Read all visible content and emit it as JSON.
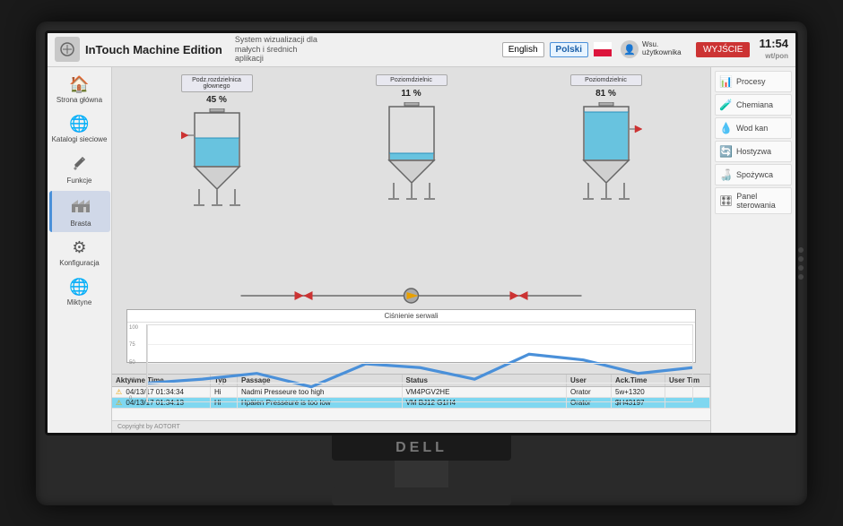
{
  "app": {
    "title": "InTouch Machine Edition",
    "subtitle": "System wizualizacji dla małych i średnich aplikacji",
    "logo_char": "🔧"
  },
  "header": {
    "lang_en": "English",
    "lang_pl": "Polski",
    "user_label": "Wsu. użytkownika",
    "logout_label": "WYJŚCIE",
    "time": "11:54",
    "date": "wt/pon"
  },
  "sidebar_left": {
    "items": [
      {
        "id": "strona-glowna",
        "label": "Strona główna",
        "icon": "🏠"
      },
      {
        "id": "katalogi-sieciowe",
        "label": "Katalogi sieciowe",
        "icon": "🌐"
      },
      {
        "id": "funkcje",
        "label": "Funkcje",
        "icon": "🔧"
      },
      {
        "id": "brasta",
        "label": "Brasta",
        "icon": "🏭",
        "active": true
      },
      {
        "id": "konfiguracja",
        "label": "Konfiguracja",
        "icon": "⚙"
      },
      {
        "id": "miktyne",
        "label": "Miktyne",
        "icon": "🌐"
      }
    ]
  },
  "sidebar_right": {
    "items": [
      {
        "id": "procesy",
        "label": "Procesy",
        "icon": "📊"
      },
      {
        "id": "chemiana",
        "label": "Chemiana",
        "icon": "🧪"
      },
      {
        "id": "wod-kan",
        "label": "Wod kan",
        "icon": "💧"
      },
      {
        "id": "hostyzwa",
        "label": "Hostyzwa",
        "icon": "🔄"
      },
      {
        "id": "spozywca",
        "label": "Spożywca",
        "icon": "🍶"
      },
      {
        "id": "panel-sterowania",
        "label": "Panel sterowania",
        "icon": "🎛"
      }
    ]
  },
  "tanks": [
    {
      "id": "tank1",
      "label": "Podz.rozdzielnica\ngłównego",
      "percent": "45 %",
      "fill": 45,
      "fill_color": "#4abcde"
    },
    {
      "id": "tank2",
      "label": "Poziomdzielnic",
      "percent": "11 %",
      "fill": 11,
      "fill_color": "#4abcde"
    },
    {
      "id": "tank3",
      "label": "Poziomdzielnic",
      "percent": "81 %",
      "fill": 81,
      "fill_color": "#4abcde"
    }
  ],
  "chart": {
    "title": "Ciśnienie serwali",
    "x_labels": [
      "",
      "",
      "",
      "",
      "",
      "",
      "",
      "",
      "",
      "",
      "",
      ""
    ]
  },
  "alarms": {
    "columns": [
      "Aktywne Time",
      "Typ",
      "Passage",
      "Status",
      "User",
      "Ack.Time",
      "User Tim"
    ],
    "rows": [
      {
        "id": "alarm1",
        "active_time": "04/13/17 01:34:34",
        "typ": "Hi",
        "passage": "Nadmi Presseure too high",
        "status": "VM4PGV2HE",
        "user": "Orator",
        "ack_time": "5w+1320",
        "user_tim": "",
        "highlight": false,
        "has_icon": true
      },
      {
        "id": "alarm2",
        "active_time": "04/13/17 01:34:13",
        "typ": "Hi",
        "passage": "Hpäien Presseure is too low",
        "status": "VM BJ12 G1H4",
        "user": "Orator",
        "ack_time": "$H43197",
        "user_tim": "",
        "highlight": true,
        "has_icon": true
      }
    ]
  },
  "footer": {
    "copyright": "Copyright by AOTORT"
  }
}
